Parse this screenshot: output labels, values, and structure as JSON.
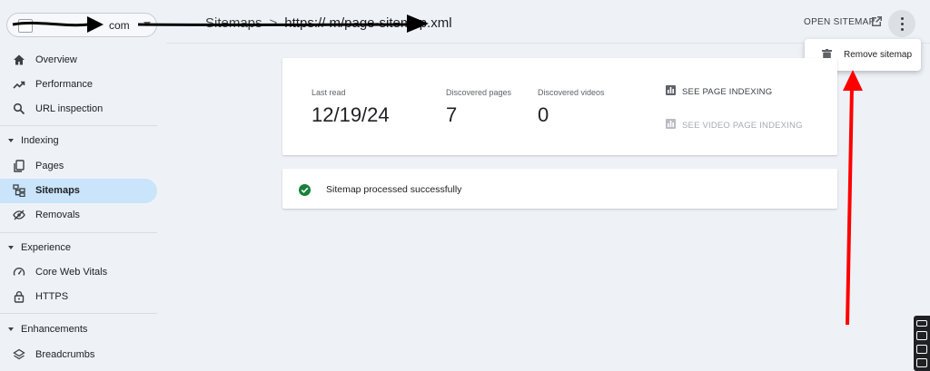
{
  "property": {
    "name_visible": "com"
  },
  "header": {
    "breadcrumb_root": "Sitemaps",
    "breadcrumb_sep": ">",
    "breadcrumb_url": "https://                    m/page-sitemap.xml",
    "open_sitemap_label": "OPEN SITEMAP"
  },
  "menu": {
    "remove_label": "Remove sitemap"
  },
  "sidebar": {
    "overview": "Overview",
    "performance": "Performance",
    "url_inspection": "URL inspection",
    "indexing_section": "Indexing",
    "pages": "Pages",
    "sitemaps": "Sitemaps",
    "removals": "Removals",
    "experience_section": "Experience",
    "core_web_vitals": "Core Web Vitals",
    "https": "HTTPS",
    "enhancements_section": "Enhancements",
    "breadcrumbs": "Breadcrumbs"
  },
  "summary": {
    "last_read_label": "Last read",
    "last_read_value": "12/19/24",
    "discovered_pages_label": "Discovered pages",
    "discovered_pages_value": "7",
    "discovered_videos_label": "Discovered videos",
    "discovered_videos_value": "0",
    "see_page_indexing": "SEE PAGE INDEXING",
    "see_video_page_indexing": "SEE VIDEO PAGE INDEXING"
  },
  "status": {
    "message": "Sitemap processed successfully"
  },
  "colors": {
    "background": "#eef2f7",
    "active_nav": "#c9e4fb",
    "success": "#188038",
    "annotation_red": "#ff0000"
  }
}
